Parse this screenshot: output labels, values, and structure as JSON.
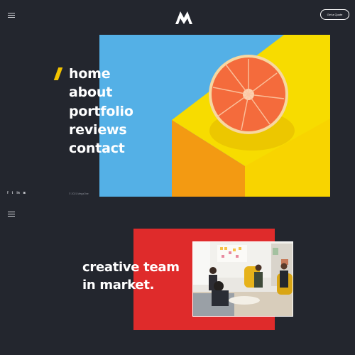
{
  "header": {
    "menu_icon": "hamburger-icon",
    "logo_icon": "brand-logo-icon",
    "cta_label": "Get a Quote"
  },
  "nav": {
    "items": [
      "home",
      "about",
      "portfolio",
      "reviews",
      "contact"
    ]
  },
  "hero": {
    "image": "orange-on-yellow-block-photo"
  },
  "social": {
    "icons": [
      "facebook-icon",
      "twitter-icon",
      "linkedin-icon",
      "instagram-icon"
    ],
    "labels": [
      "f",
      "t",
      "in",
      "◙"
    ]
  },
  "footer": {
    "copyright": "© 2021 MegaOne"
  },
  "section2": {
    "menu_icon": "hamburger-icon",
    "headline_line1": "creative team",
    "headline_line2": "in market.",
    "photo": "team-meeting-photo"
  },
  "colors": {
    "background": "#23262e",
    "accent_yellow": "#f2c300",
    "accent_red": "#df2b2b",
    "hero_blue": "#54b0e6",
    "hero_yellow": "#f7dc00"
  }
}
